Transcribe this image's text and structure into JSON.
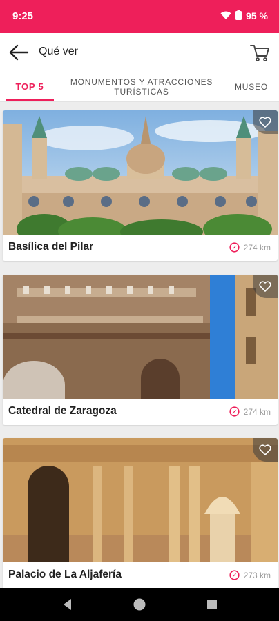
{
  "status_bar": {
    "time": "9:25",
    "battery": "95 %"
  },
  "app_bar": {
    "title": "Qué ver",
    "back_icon": "arrow-left-icon",
    "cart_icon": "shopping-cart-icon"
  },
  "tabs": [
    {
      "label": "TOP 5"
    },
    {
      "label": "MONUMENTOS Y ATRACCIONES TURÍSTICAS"
    },
    {
      "label": "MUSEO"
    }
  ],
  "colors": {
    "accent": "#ee1f5a"
  },
  "places": [
    {
      "name": "Basílica del Pilar",
      "distance": "274 km",
      "icon": "favorite-heart-icon"
    },
    {
      "name": "Catedral de Zaragoza",
      "distance": "274 km",
      "icon": "favorite-heart-icon"
    },
    {
      "name": "Palacio de La Aljafería",
      "distance": "273 km",
      "icon": "favorite-heart-icon"
    }
  ]
}
